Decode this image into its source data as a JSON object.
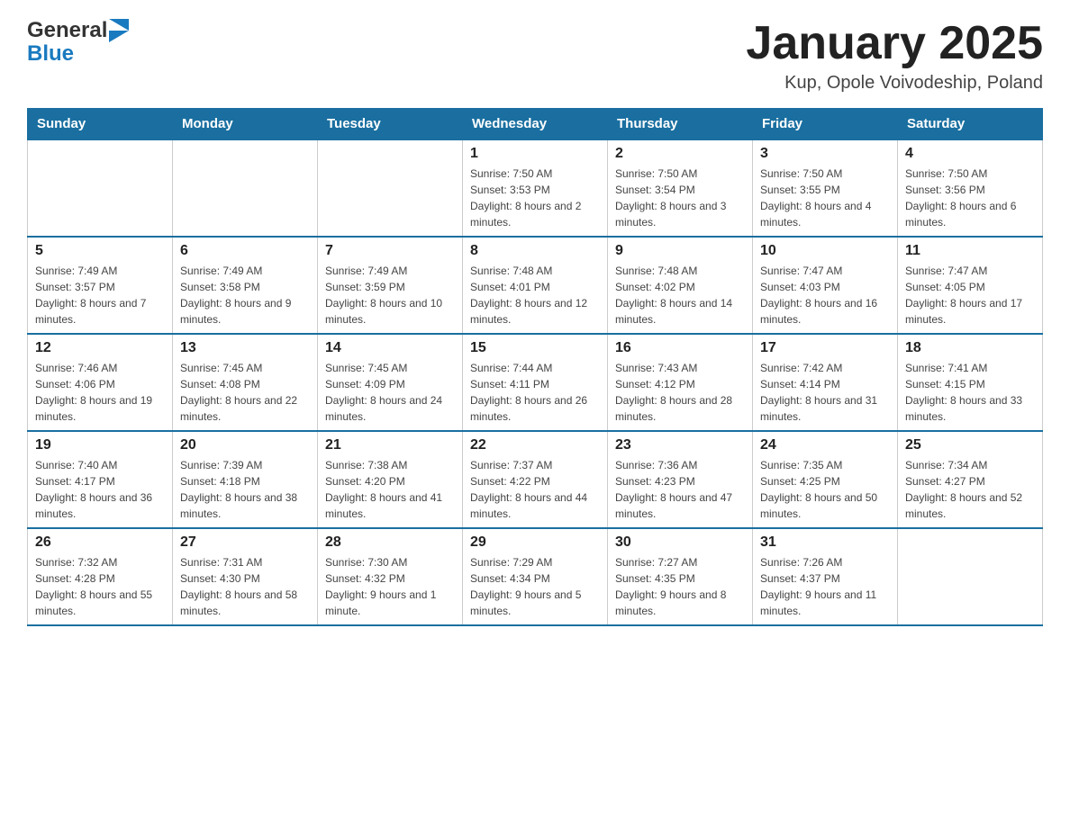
{
  "header": {
    "title": "January 2025",
    "subtitle": "Kup, Opole Voivodeship, Poland",
    "logo_general": "General",
    "logo_blue": "Blue"
  },
  "weekdays": [
    "Sunday",
    "Monday",
    "Tuesday",
    "Wednesday",
    "Thursday",
    "Friday",
    "Saturday"
  ],
  "weeks": [
    [
      {
        "day": "",
        "sunrise": "",
        "sunset": "",
        "daylight": ""
      },
      {
        "day": "",
        "sunrise": "",
        "sunset": "",
        "daylight": ""
      },
      {
        "day": "",
        "sunrise": "",
        "sunset": "",
        "daylight": ""
      },
      {
        "day": "1",
        "sunrise": "Sunrise: 7:50 AM",
        "sunset": "Sunset: 3:53 PM",
        "daylight": "Daylight: 8 hours and 2 minutes."
      },
      {
        "day": "2",
        "sunrise": "Sunrise: 7:50 AM",
        "sunset": "Sunset: 3:54 PM",
        "daylight": "Daylight: 8 hours and 3 minutes."
      },
      {
        "day": "3",
        "sunrise": "Sunrise: 7:50 AM",
        "sunset": "Sunset: 3:55 PM",
        "daylight": "Daylight: 8 hours and 4 minutes."
      },
      {
        "day": "4",
        "sunrise": "Sunrise: 7:50 AM",
        "sunset": "Sunset: 3:56 PM",
        "daylight": "Daylight: 8 hours and 6 minutes."
      }
    ],
    [
      {
        "day": "5",
        "sunrise": "Sunrise: 7:49 AM",
        "sunset": "Sunset: 3:57 PM",
        "daylight": "Daylight: 8 hours and 7 minutes."
      },
      {
        "day": "6",
        "sunrise": "Sunrise: 7:49 AM",
        "sunset": "Sunset: 3:58 PM",
        "daylight": "Daylight: 8 hours and 9 minutes."
      },
      {
        "day": "7",
        "sunrise": "Sunrise: 7:49 AM",
        "sunset": "Sunset: 3:59 PM",
        "daylight": "Daylight: 8 hours and 10 minutes."
      },
      {
        "day": "8",
        "sunrise": "Sunrise: 7:48 AM",
        "sunset": "Sunset: 4:01 PM",
        "daylight": "Daylight: 8 hours and 12 minutes."
      },
      {
        "day": "9",
        "sunrise": "Sunrise: 7:48 AM",
        "sunset": "Sunset: 4:02 PM",
        "daylight": "Daylight: 8 hours and 14 minutes."
      },
      {
        "day": "10",
        "sunrise": "Sunrise: 7:47 AM",
        "sunset": "Sunset: 4:03 PM",
        "daylight": "Daylight: 8 hours and 16 minutes."
      },
      {
        "day": "11",
        "sunrise": "Sunrise: 7:47 AM",
        "sunset": "Sunset: 4:05 PM",
        "daylight": "Daylight: 8 hours and 17 minutes."
      }
    ],
    [
      {
        "day": "12",
        "sunrise": "Sunrise: 7:46 AM",
        "sunset": "Sunset: 4:06 PM",
        "daylight": "Daylight: 8 hours and 19 minutes."
      },
      {
        "day": "13",
        "sunrise": "Sunrise: 7:45 AM",
        "sunset": "Sunset: 4:08 PM",
        "daylight": "Daylight: 8 hours and 22 minutes."
      },
      {
        "day": "14",
        "sunrise": "Sunrise: 7:45 AM",
        "sunset": "Sunset: 4:09 PM",
        "daylight": "Daylight: 8 hours and 24 minutes."
      },
      {
        "day": "15",
        "sunrise": "Sunrise: 7:44 AM",
        "sunset": "Sunset: 4:11 PM",
        "daylight": "Daylight: 8 hours and 26 minutes."
      },
      {
        "day": "16",
        "sunrise": "Sunrise: 7:43 AM",
        "sunset": "Sunset: 4:12 PM",
        "daylight": "Daylight: 8 hours and 28 minutes."
      },
      {
        "day": "17",
        "sunrise": "Sunrise: 7:42 AM",
        "sunset": "Sunset: 4:14 PM",
        "daylight": "Daylight: 8 hours and 31 minutes."
      },
      {
        "day": "18",
        "sunrise": "Sunrise: 7:41 AM",
        "sunset": "Sunset: 4:15 PM",
        "daylight": "Daylight: 8 hours and 33 minutes."
      }
    ],
    [
      {
        "day": "19",
        "sunrise": "Sunrise: 7:40 AM",
        "sunset": "Sunset: 4:17 PM",
        "daylight": "Daylight: 8 hours and 36 minutes."
      },
      {
        "day": "20",
        "sunrise": "Sunrise: 7:39 AM",
        "sunset": "Sunset: 4:18 PM",
        "daylight": "Daylight: 8 hours and 38 minutes."
      },
      {
        "day": "21",
        "sunrise": "Sunrise: 7:38 AM",
        "sunset": "Sunset: 4:20 PM",
        "daylight": "Daylight: 8 hours and 41 minutes."
      },
      {
        "day": "22",
        "sunrise": "Sunrise: 7:37 AM",
        "sunset": "Sunset: 4:22 PM",
        "daylight": "Daylight: 8 hours and 44 minutes."
      },
      {
        "day": "23",
        "sunrise": "Sunrise: 7:36 AM",
        "sunset": "Sunset: 4:23 PM",
        "daylight": "Daylight: 8 hours and 47 minutes."
      },
      {
        "day": "24",
        "sunrise": "Sunrise: 7:35 AM",
        "sunset": "Sunset: 4:25 PM",
        "daylight": "Daylight: 8 hours and 50 minutes."
      },
      {
        "day": "25",
        "sunrise": "Sunrise: 7:34 AM",
        "sunset": "Sunset: 4:27 PM",
        "daylight": "Daylight: 8 hours and 52 minutes."
      }
    ],
    [
      {
        "day": "26",
        "sunrise": "Sunrise: 7:32 AM",
        "sunset": "Sunset: 4:28 PM",
        "daylight": "Daylight: 8 hours and 55 minutes."
      },
      {
        "day": "27",
        "sunrise": "Sunrise: 7:31 AM",
        "sunset": "Sunset: 4:30 PM",
        "daylight": "Daylight: 8 hours and 58 minutes."
      },
      {
        "day": "28",
        "sunrise": "Sunrise: 7:30 AM",
        "sunset": "Sunset: 4:32 PM",
        "daylight": "Daylight: 9 hours and 1 minute."
      },
      {
        "day": "29",
        "sunrise": "Sunrise: 7:29 AM",
        "sunset": "Sunset: 4:34 PM",
        "daylight": "Daylight: 9 hours and 5 minutes."
      },
      {
        "day": "30",
        "sunrise": "Sunrise: 7:27 AM",
        "sunset": "Sunset: 4:35 PM",
        "daylight": "Daylight: 9 hours and 8 minutes."
      },
      {
        "day": "31",
        "sunrise": "Sunrise: 7:26 AM",
        "sunset": "Sunset: 4:37 PM",
        "daylight": "Daylight: 9 hours and 11 minutes."
      },
      {
        "day": "",
        "sunrise": "",
        "sunset": "",
        "daylight": ""
      }
    ]
  ]
}
